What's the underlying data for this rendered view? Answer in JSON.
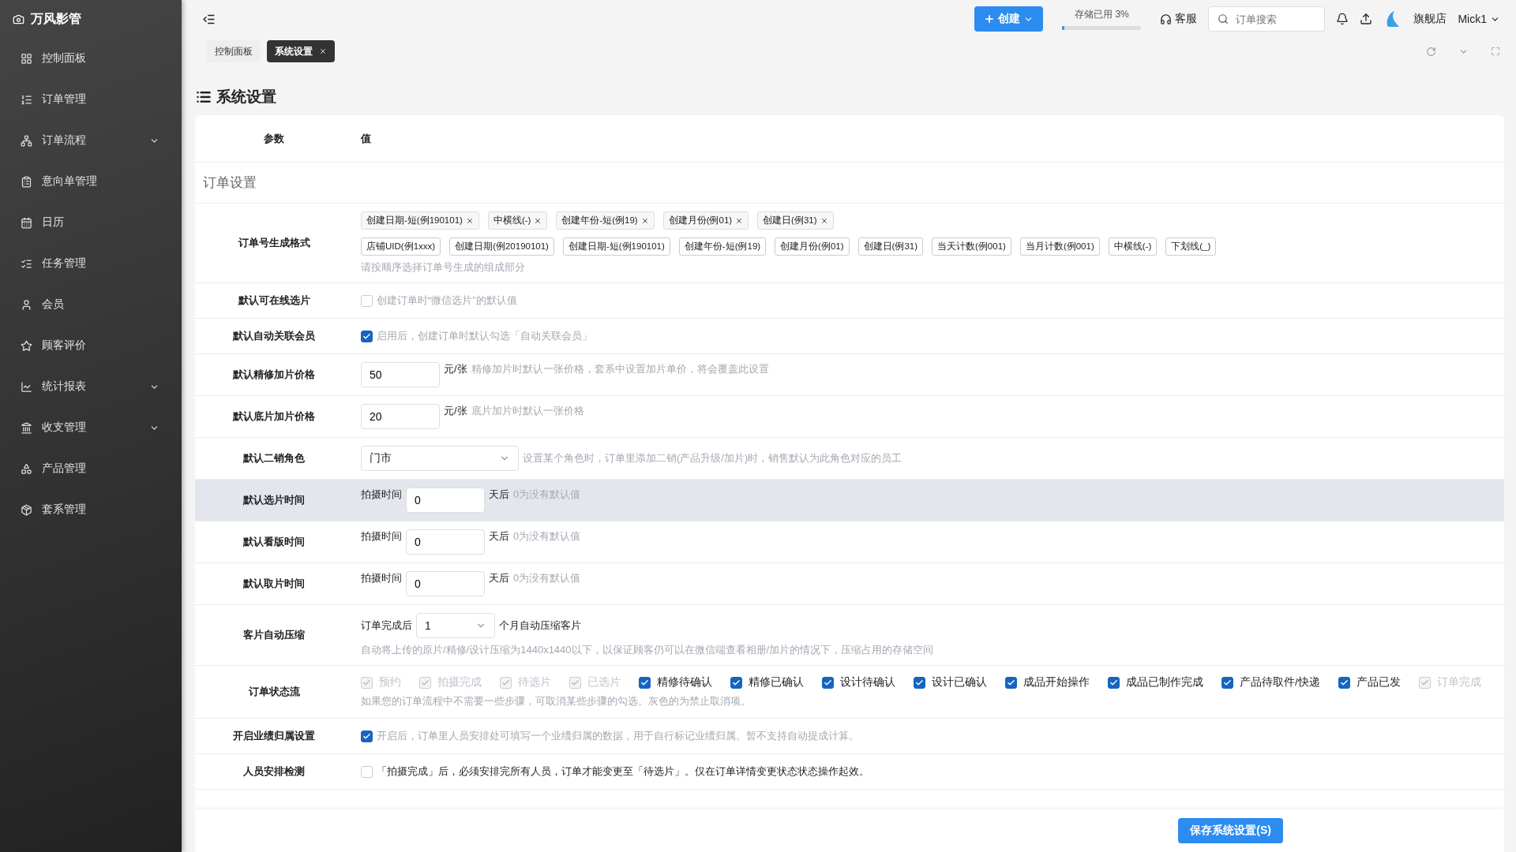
{
  "sidebar": {
    "brand": "万风影管",
    "items": [
      {
        "label": "控制面板",
        "has_submenu": false
      },
      {
        "label": "订单管理",
        "has_submenu": false
      },
      {
        "label": "订单流程",
        "has_submenu": true
      },
      {
        "label": "意向单管理",
        "has_submenu": false
      },
      {
        "label": "日历",
        "has_submenu": false
      },
      {
        "label": "任务管理",
        "has_submenu": false
      },
      {
        "label": "会员",
        "has_submenu": false
      },
      {
        "label": "顾客评价",
        "has_submenu": false
      },
      {
        "label": "统计报表",
        "has_submenu": true
      },
      {
        "label": "收支管理",
        "has_submenu": true
      },
      {
        "label": "产品管理",
        "has_submenu": false
      },
      {
        "label": "套系管理",
        "has_submenu": false
      }
    ]
  },
  "header": {
    "create_button": "创建",
    "storage": {
      "label": "存储已用 3%",
      "level": 0.03
    },
    "service": "客服",
    "search": {
      "placeholder": "订单搜索"
    },
    "store": "旗舰店",
    "user": "Mick1"
  },
  "tabs": [
    {
      "label": "控制面板",
      "selected": false,
      "closable": false
    },
    {
      "label": "系统设置",
      "selected": true,
      "closable": true
    }
  ],
  "page_title": "系统设置",
  "table": {
    "columns": [
      "参数",
      "值"
    ],
    "section": "订单设置",
    "rows": [
      {
        "kind": "format",
        "label": "订单号生成格式",
        "selected_tags": [
          "创建日期-短(例190101)",
          "中横线(-)",
          "创建年份-短(例19)",
          "创建月份(例01)",
          "创建日(例31)"
        ],
        "options": [
          "店铺UID(例1xxx)",
          "创建日期(例20190101)",
          "创建日期-短(例190101)",
          "创建年份-短(例19)",
          "创建月份(例01)",
          "创建日(例31)",
          "当天计数(例001)",
          "当月计数(例001)",
          "中横线(-)",
          "下划线(_)"
        ],
        "hint": "请按顺序选择订单号生成的组成部分"
      },
      {
        "kind": "checkbox",
        "label": "默认可在线选片",
        "checked": false,
        "hint": "创建订单时“微信选片”的默认值"
      },
      {
        "kind": "checkbox",
        "label": "默认自动关联会员",
        "checked": true,
        "hint": "启用后，创建订单时默认勾选「自动关联会员」"
      },
      {
        "kind": "price",
        "label": "默认精修加片价格",
        "value": "50",
        "unit": "元/张",
        "hint": "精修加片时默认一张价格，套系中设置加片单价，将会覆盖此设置"
      },
      {
        "kind": "price",
        "label": "默认底片加片价格",
        "value": "20",
        "unit": "元/张",
        "hint": "底片加片时默认一张价格"
      },
      {
        "kind": "select",
        "label": "默认二销角色",
        "value": "门市",
        "hint": "设置某个角色时，订单里添加二销(产品升级/加片)时，销售默认为此角色对应的员工"
      },
      {
        "kind": "days",
        "label": "默认选片时间",
        "hovered": true,
        "prefix": "拍摄时间",
        "value": "0",
        "suffix": "天后",
        "hint": "0为没有默认值"
      },
      {
        "kind": "days",
        "label": "默认看版时间",
        "hovered": false,
        "prefix": "拍摄时间",
        "value": "0",
        "suffix": "天后",
        "hint": "0为没有默认值"
      },
      {
        "kind": "days",
        "label": "默认取片时间",
        "hovered": false,
        "prefix": "拍摄时间",
        "value": "0",
        "suffix": "天后",
        "hint": "0为没有默认值"
      },
      {
        "kind": "compress",
        "label": "客片自动压缩",
        "prefix": "订单完成后",
        "months": "1",
        "suffix": "个月自动压缩客片",
        "hint": "自动将上传的原片/精修/设计压缩为1440x1440以下，以保证顾客仍可以在微信端查看相册/加片的情况下，压缩占用的存储空间"
      },
      {
        "kind": "steps",
        "label": "订单状态流",
        "steps": [
          {
            "label": "预约",
            "checked": true,
            "disabled": true
          },
          {
            "label": "拍摄完成",
            "checked": true,
            "disabled": true
          },
          {
            "label": "待选片",
            "checked": true,
            "disabled": true
          },
          {
            "label": "已选片",
            "checked": true,
            "disabled": true
          },
          {
            "label": "精修待确认",
            "checked": true,
            "disabled": false
          },
          {
            "label": "精修已确认",
            "checked": true,
            "disabled": false
          },
          {
            "label": "设计待确认",
            "checked": true,
            "disabled": false
          },
          {
            "label": "设计已确认",
            "checked": true,
            "disabled": false
          },
          {
            "label": "成品开始操作",
            "checked": true,
            "disabled": false
          },
          {
            "label": "成品已制作完成",
            "checked": true,
            "disabled": false
          },
          {
            "label": "产品待取件/快递",
            "checked": true,
            "disabled": false
          },
          {
            "label": "产品已发",
            "checked": true,
            "disabled": false
          },
          {
            "label": "订单完成",
            "checked": true,
            "disabled": true
          }
        ],
        "hint": "如果您的订单流程中不需要一些步骤，可取消某些步骤的勾选。灰色的为禁止取消项。"
      },
      {
        "kind": "checkbox",
        "label": "开启业绩归属设置",
        "checked": true,
        "hint": "开启后，订单里人员安排处可填写一个业绩归属的数据，用于自行标记业绩归属。暂不支持自动提成计算。"
      },
      {
        "kind": "checkbox",
        "label": "人员安排检测",
        "checked": false,
        "text": "「拍摄完成」后，必须安排完所有人员，订单才能变更至「待选片」。仅在订单详情变更状态状态操作起效。"
      }
    ]
  },
  "footer": {
    "save_button": "保存系统设置(S)"
  }
}
